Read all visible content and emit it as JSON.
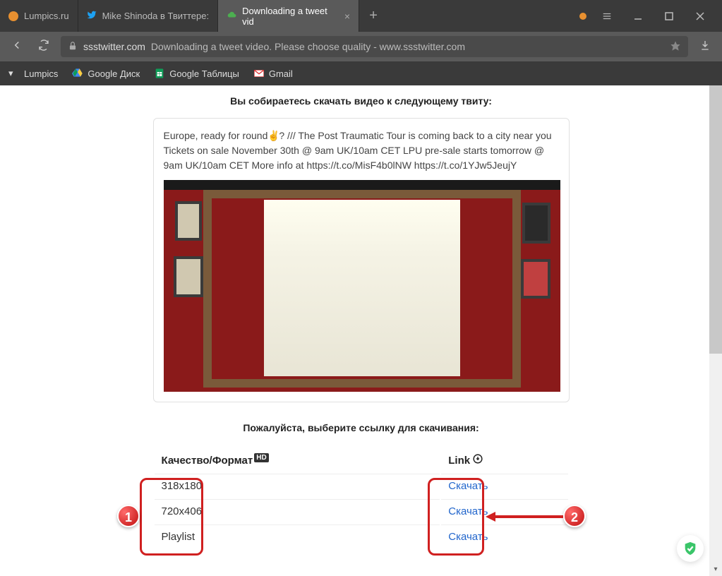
{
  "tabs": [
    {
      "title": "Lumpics.ru",
      "icon_color": "#e89030"
    },
    {
      "title": "Mike Shinoda в Твиттере:",
      "icon_color": "#1da1f2"
    },
    {
      "title": "Downloading a tweet vid",
      "icon_color": "#4caf50",
      "active": true
    }
  ],
  "address": {
    "domain": "ssstwitter.com",
    "title": "Downloading a tweet video. Please choose quality - www.ssstwitter.com"
  },
  "bookmarks": [
    {
      "label": "Lumpics"
    },
    {
      "label": "Google Диск"
    },
    {
      "label": "Google Таблицы"
    },
    {
      "label": "Gmail"
    }
  ],
  "page": {
    "heading": "Вы собираетесь скачать видео к следующему твиту:",
    "tweet_text_1": "Europe, ready for round",
    "tweet_emoji": "✌️",
    "tweet_text_2": "? /// The Post Traumatic Tour is coming back to a city near you Tickets on sale November 30th @ 9am UK/10am CET   LPU pre-sale starts tomorrow @ 9am UK/10am CET More info at https://t.co/MisF4b0lNW https://t.co/1YJw5JeujY",
    "subheading": "Пожалуйста, выберите ссылку для скачивания:",
    "table": {
      "col_quality": "Качество/Формат",
      "col_link": "Link",
      "rows": [
        {
          "quality": "318x180",
          "link": "Скачать"
        },
        {
          "quality": "720x406",
          "link": "Скачать"
        },
        {
          "quality": "Playlist",
          "link": "Скачать"
        }
      ]
    }
  },
  "annotations": {
    "num1": "1",
    "num2": "2"
  }
}
